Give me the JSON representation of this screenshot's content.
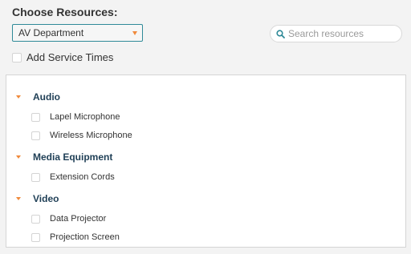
{
  "heading": "Choose Resources:",
  "department_select": {
    "value": "AV Department"
  },
  "search": {
    "placeholder": "Search resources"
  },
  "service_times": {
    "label": "Add Service Times"
  },
  "colors": {
    "accent": "#f08a3c",
    "select_border": "#2f8a98",
    "group_text": "#1f3f56"
  },
  "groups": [
    {
      "name": "Audio",
      "items": [
        "Lapel Microphone",
        "Wireless Microphone"
      ]
    },
    {
      "name": "Media Equipment",
      "items": [
        "Extension Cords"
      ]
    },
    {
      "name": "Video",
      "items": [
        "Data Projector",
        "Projection Screen"
      ]
    }
  ]
}
